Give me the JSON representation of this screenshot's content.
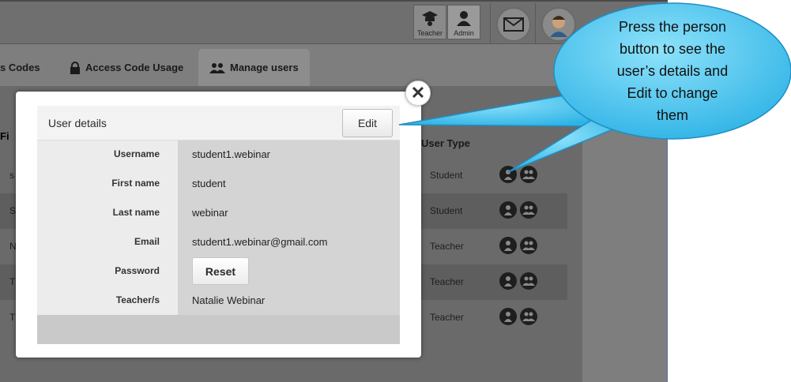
{
  "topbar": {
    "roles": [
      {
        "label": "Teacher"
      },
      {
        "label": "Admin"
      }
    ],
    "mail_icon": "envelope-icon",
    "avatar_icon": "user-avatar-icon"
  },
  "tabs": [
    {
      "label": "s Codes",
      "icon": ""
    },
    {
      "label": "Access Code Usage",
      "icon": "lock-icon"
    },
    {
      "label": "Manage users",
      "icon": "users-icon"
    }
  ],
  "table": {
    "header_partial": "Fi",
    "user_type_header": "User Type",
    "rows": [
      {
        "first_char": "s",
        "user_type": "Student"
      },
      {
        "first_char": "S",
        "user_type": "Student"
      },
      {
        "first_char": "N",
        "user_type": "Teacher"
      },
      {
        "first_char": "T",
        "user_type": "Teacher"
      },
      {
        "first_char": "T",
        "user_type": "Teacher"
      }
    ]
  },
  "modal": {
    "title": "User details",
    "edit_label": "Edit",
    "close_symbol": "✕",
    "fields": [
      {
        "label": "Username",
        "value": "student1.webinar"
      },
      {
        "label": "First name",
        "value": "student"
      },
      {
        "label": "Last name",
        "value": "webinar"
      },
      {
        "label": "Email",
        "value": "student1.webinar@gmail.com"
      },
      {
        "label": "Password",
        "value": ""
      },
      {
        "label": "Teacher/s",
        "value": "Natalie Webinar"
      }
    ],
    "reset_label": "Reset"
  },
  "callout": {
    "lines": [
      "Press the person",
      "button to see the",
      "user’s details and",
      "Edit to change",
      "them"
    ],
    "fill_color": "#4fc6ef"
  }
}
